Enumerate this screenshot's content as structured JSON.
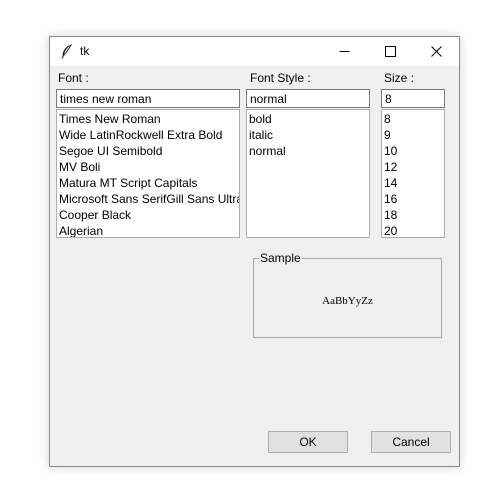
{
  "window": {
    "title": "tk"
  },
  "font": {
    "label": "Font :",
    "value": "times new roman",
    "items": [
      "Times New Roman",
      "Wide LatinRockwell Extra Bold",
      "Segoe UI Semibold",
      "MV Boli",
      "Matura MT Script Capitals",
      "Microsoft Sans SerifGill Sans Ultra",
      "Cooper Black",
      "Algerian"
    ]
  },
  "style": {
    "label": "Font Style :",
    "value": "normal",
    "items": [
      "bold",
      "italic",
      "normal"
    ]
  },
  "size": {
    "label": "Size :",
    "value": "8",
    "items": [
      "8",
      "9",
      "10",
      "12",
      "14",
      "16",
      "18",
      "20"
    ]
  },
  "sample": {
    "legend": "Sample",
    "text": "AaBbYyZz"
  },
  "buttons": {
    "ok": "OK",
    "cancel": "Cancel"
  },
  "icons": [
    "feather-icon",
    "minimize-icon",
    "maximize-icon",
    "close-icon"
  ]
}
